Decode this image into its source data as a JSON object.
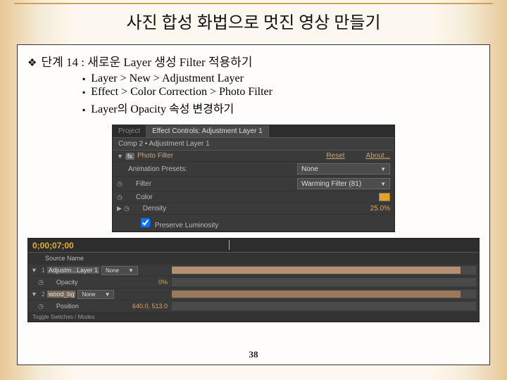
{
  "title": "사진 합성 화법으로 멋진 영상 만들기",
  "step": {
    "heading": "단계 14 : 새로운 Layer 생성 Filter 적용하기",
    "bullets": [
      "Layer > New > Adjustment Layer",
      "Effect > Color Correction > Photo Filter",
      "Layer의 Opacity 속성 변경하기"
    ]
  },
  "effectControls": {
    "tabProject": "Project",
    "tabActive": "Effect Controls: Adjustment Layer 1",
    "breadcrumb": "Comp 2 • Adjustment Layer 1",
    "effectName": "Photo Filter",
    "reset": "Reset",
    "about": "About...",
    "presetsLabel": "Animation Presets:",
    "presetsValue": "None",
    "filterLabel": "Filter",
    "filterValue": "Warming Filter (81)",
    "colorLabel": "Color",
    "densityLabel": "Density",
    "densityValue": "25.0%",
    "preserveLabel": "Preserve Luminosity"
  },
  "timeline": {
    "timecode": "0;00;07;00",
    "headerSource": "Source Name",
    "layer1": "Adjustm...Layer 1",
    "layer1mode": "None",
    "layer1num": "1",
    "opacityLabel": "Opacity",
    "opacityValue": "0%",
    "layer2": "wood_bg",
    "layer2num": "2",
    "layer2mode": "None",
    "positionLabel": "Position",
    "positionValue": "640.0, 513.0",
    "toggle": "Toggle Switches / Modes"
  },
  "pageNumber": "38"
}
